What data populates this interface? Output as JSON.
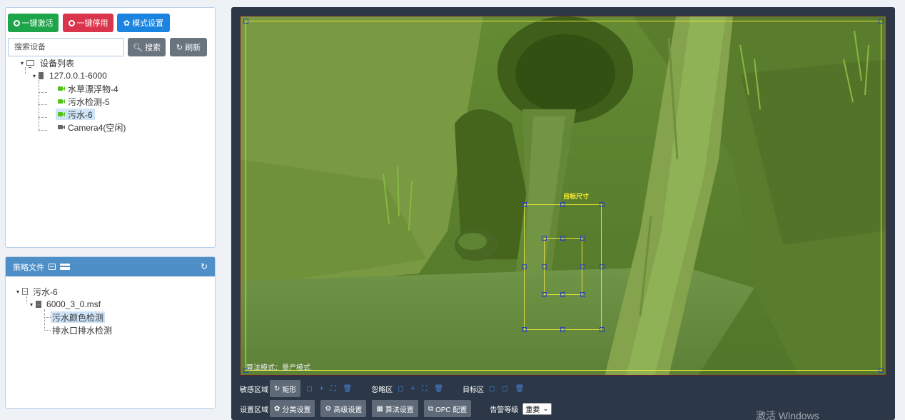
{
  "toolbar": {
    "activate_all": "一键激活",
    "deactivate_all": "一键停用",
    "mode_settings": "模式设置",
    "search_placeholder": "搜索设备",
    "search_btn": "搜索",
    "refresh_btn": "刷新"
  },
  "device_tree": {
    "root": "设备列表",
    "server": "127.0.0.1-6000",
    "cameras": [
      {
        "label": "水草漂浮物-4",
        "status": "active"
      },
      {
        "label": "污水检测-5",
        "status": "active"
      },
      {
        "label": "污水-6",
        "status": "active",
        "selected": true
      },
      {
        "label": "Camera4(空闲)",
        "status": "idle"
      }
    ]
  },
  "strategy": {
    "header": "策略文件",
    "root": "污水-6",
    "file": "6000_3_0.msf",
    "items": [
      {
        "label": "污水颜色检测",
        "selected": true
      },
      {
        "label": "排水口排水检测"
      }
    ]
  },
  "video": {
    "target_size_label": "目标尺寸",
    "mode_text": "算法模式：量产模式"
  },
  "controls": {
    "sensitive_area": "敏感区域",
    "rect_btn": "矩形",
    "ignore_area": "忽略区",
    "target_area": "目标区",
    "setup_area": "设置区域",
    "classify_btn": "分类设置",
    "advanced_btn": "高级设置",
    "algo_btn": "算法设置",
    "opc_btn": "OPC 配置",
    "alarm_level_label": "告警等级",
    "alarm_level_value": "重要"
  },
  "watermark": "激活 Windows",
  "colors": {
    "green": "#1ea54a",
    "red": "#d9364d",
    "blue": "#1b84e0",
    "header": "#4f8fc7",
    "dark_panel": "#2c3848",
    "roi": "#e8e23a"
  }
}
